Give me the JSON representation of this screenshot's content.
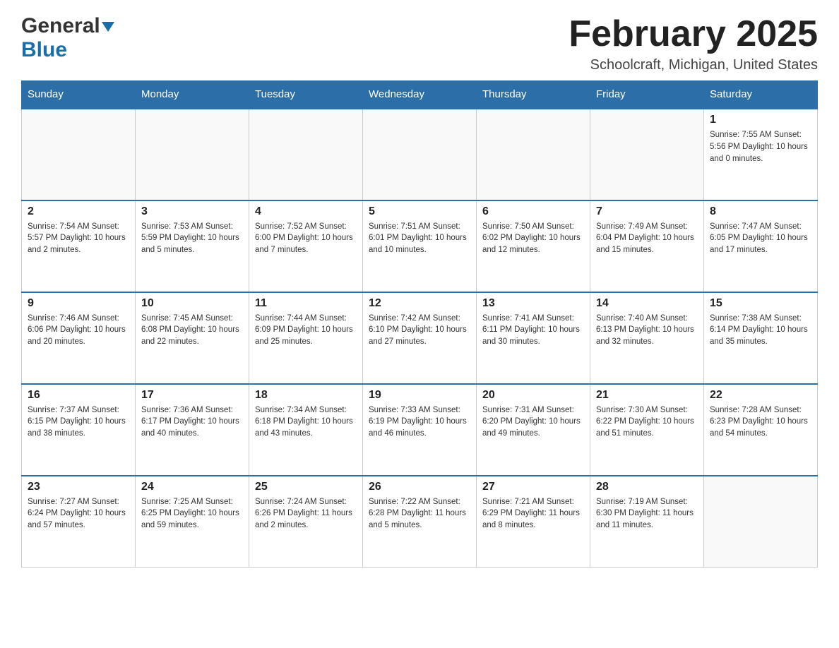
{
  "header": {
    "logo_general": "General",
    "logo_blue": "Blue",
    "main_title": "February 2025",
    "subtitle": "Schoolcraft, Michigan, United States"
  },
  "weekdays": [
    "Sunday",
    "Monday",
    "Tuesday",
    "Wednesday",
    "Thursday",
    "Friday",
    "Saturday"
  ],
  "weeks": [
    [
      {
        "day": "",
        "info": ""
      },
      {
        "day": "",
        "info": ""
      },
      {
        "day": "",
        "info": ""
      },
      {
        "day": "",
        "info": ""
      },
      {
        "day": "",
        "info": ""
      },
      {
        "day": "",
        "info": ""
      },
      {
        "day": "1",
        "info": "Sunrise: 7:55 AM\nSunset: 5:56 PM\nDaylight: 10 hours\nand 0 minutes."
      }
    ],
    [
      {
        "day": "2",
        "info": "Sunrise: 7:54 AM\nSunset: 5:57 PM\nDaylight: 10 hours\nand 2 minutes."
      },
      {
        "day": "3",
        "info": "Sunrise: 7:53 AM\nSunset: 5:59 PM\nDaylight: 10 hours\nand 5 minutes."
      },
      {
        "day": "4",
        "info": "Sunrise: 7:52 AM\nSunset: 6:00 PM\nDaylight: 10 hours\nand 7 minutes."
      },
      {
        "day": "5",
        "info": "Sunrise: 7:51 AM\nSunset: 6:01 PM\nDaylight: 10 hours\nand 10 minutes."
      },
      {
        "day": "6",
        "info": "Sunrise: 7:50 AM\nSunset: 6:02 PM\nDaylight: 10 hours\nand 12 minutes."
      },
      {
        "day": "7",
        "info": "Sunrise: 7:49 AM\nSunset: 6:04 PM\nDaylight: 10 hours\nand 15 minutes."
      },
      {
        "day": "8",
        "info": "Sunrise: 7:47 AM\nSunset: 6:05 PM\nDaylight: 10 hours\nand 17 minutes."
      }
    ],
    [
      {
        "day": "9",
        "info": "Sunrise: 7:46 AM\nSunset: 6:06 PM\nDaylight: 10 hours\nand 20 minutes."
      },
      {
        "day": "10",
        "info": "Sunrise: 7:45 AM\nSunset: 6:08 PM\nDaylight: 10 hours\nand 22 minutes."
      },
      {
        "day": "11",
        "info": "Sunrise: 7:44 AM\nSunset: 6:09 PM\nDaylight: 10 hours\nand 25 minutes."
      },
      {
        "day": "12",
        "info": "Sunrise: 7:42 AM\nSunset: 6:10 PM\nDaylight: 10 hours\nand 27 minutes."
      },
      {
        "day": "13",
        "info": "Sunrise: 7:41 AM\nSunset: 6:11 PM\nDaylight: 10 hours\nand 30 minutes."
      },
      {
        "day": "14",
        "info": "Sunrise: 7:40 AM\nSunset: 6:13 PM\nDaylight: 10 hours\nand 32 minutes."
      },
      {
        "day": "15",
        "info": "Sunrise: 7:38 AM\nSunset: 6:14 PM\nDaylight: 10 hours\nand 35 minutes."
      }
    ],
    [
      {
        "day": "16",
        "info": "Sunrise: 7:37 AM\nSunset: 6:15 PM\nDaylight: 10 hours\nand 38 minutes."
      },
      {
        "day": "17",
        "info": "Sunrise: 7:36 AM\nSunset: 6:17 PM\nDaylight: 10 hours\nand 40 minutes."
      },
      {
        "day": "18",
        "info": "Sunrise: 7:34 AM\nSunset: 6:18 PM\nDaylight: 10 hours\nand 43 minutes."
      },
      {
        "day": "19",
        "info": "Sunrise: 7:33 AM\nSunset: 6:19 PM\nDaylight: 10 hours\nand 46 minutes."
      },
      {
        "day": "20",
        "info": "Sunrise: 7:31 AM\nSunset: 6:20 PM\nDaylight: 10 hours\nand 49 minutes."
      },
      {
        "day": "21",
        "info": "Sunrise: 7:30 AM\nSunset: 6:22 PM\nDaylight: 10 hours\nand 51 minutes."
      },
      {
        "day": "22",
        "info": "Sunrise: 7:28 AM\nSunset: 6:23 PM\nDaylight: 10 hours\nand 54 minutes."
      }
    ],
    [
      {
        "day": "23",
        "info": "Sunrise: 7:27 AM\nSunset: 6:24 PM\nDaylight: 10 hours\nand 57 minutes."
      },
      {
        "day": "24",
        "info": "Sunrise: 7:25 AM\nSunset: 6:25 PM\nDaylight: 10 hours\nand 59 minutes."
      },
      {
        "day": "25",
        "info": "Sunrise: 7:24 AM\nSunset: 6:26 PM\nDaylight: 11 hours\nand 2 minutes."
      },
      {
        "day": "26",
        "info": "Sunrise: 7:22 AM\nSunset: 6:28 PM\nDaylight: 11 hours\nand 5 minutes."
      },
      {
        "day": "27",
        "info": "Sunrise: 7:21 AM\nSunset: 6:29 PM\nDaylight: 11 hours\nand 8 minutes."
      },
      {
        "day": "28",
        "info": "Sunrise: 7:19 AM\nSunset: 6:30 PM\nDaylight: 11 hours\nand 11 minutes."
      },
      {
        "day": "",
        "info": ""
      }
    ]
  ]
}
